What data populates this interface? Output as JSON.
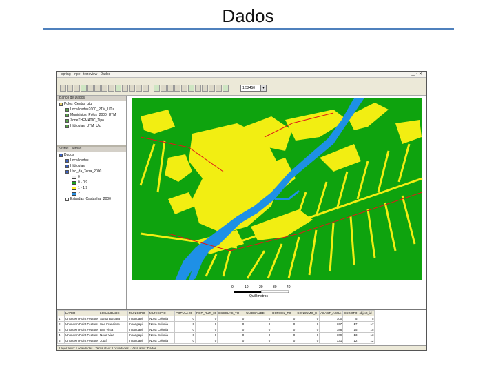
{
  "slide": {
    "title": "Dados"
  },
  "app": {
    "window_title": "spring - inpe - terraview - Dados",
    "scale_value": "1:52450",
    "toolbar_icons": [
      "new-icon",
      "open-icon",
      "save-icon",
      "layer-icon",
      "view-icon",
      "table-icon",
      "print-icon",
      "add-theme-icon",
      "query-icon",
      "legend-icon",
      "graph-icon",
      "refresh-icon",
      "text-icon",
      "pointer-icon",
      "zoom-in-icon",
      "zoom-out-icon",
      "pan-icon",
      "info-icon",
      "select-icon",
      "measure-icon",
      "edit-icon",
      "draw-icon",
      "area-icon",
      "color-icon"
    ]
  },
  "database_panel": {
    "header": "Banco de Dados",
    "items": [
      {
        "label": "Polos_Centro_utu",
        "color": "#e8d070"
      },
      {
        "label": "Localidades2000_PTM_UTu",
        "color": "#5aa84a"
      },
      {
        "label": "Municipios_Polos_2000_UTM",
        "color": "#5aa84a"
      },
      {
        "label": "ZoneTHEMATIC_Tipo",
        "color": "#5aa84a"
      },
      {
        "label": "Hidrovias_UTM_Utp",
        "color": "#5aa84a"
      }
    ]
  },
  "views_panel": {
    "header": "Vistas / Temas",
    "items": [
      {
        "label": "Dados",
        "indent": 0,
        "checked": true
      },
      {
        "label": "Localidades",
        "indent": 1,
        "checked": true
      },
      {
        "label": "Hidrovias",
        "indent": 1,
        "checked": true
      },
      {
        "label": "Uso_da_Terra_2000",
        "indent": 1,
        "checked": true
      },
      {
        "label": "0",
        "indent": 2,
        "swatch": "#f0f0f0"
      },
      {
        "label": "0 - 0.9",
        "indent": 2,
        "swatch": "#1f9e1f"
      },
      {
        "label": "1 - 1.9",
        "indent": 2,
        "swatch": "#ffee22"
      },
      {
        "label": "2",
        "indent": 2,
        "swatch": "#2a8fe0"
      },
      {
        "label": "Estradas_Castanhal_2000",
        "indent": 1,
        "checked": false
      }
    ]
  },
  "map": {
    "colors": {
      "forest": "#0ea30e",
      "deforested": "#f2ee12",
      "river": "#1e90e6",
      "road": "#e01818"
    },
    "scale_ticks": [
      "0",
      "10",
      "20",
      "30",
      "40"
    ],
    "scale_unit": "Quilômetros"
  },
  "table": {
    "columns": [
      "",
      "LAYER",
      "LOCALIDADE",
      "MUNICIPIO",
      "MUNICIPIO",
      "POPULA 00",
      "POP_RUR_00",
      "ESCOLAS_TO",
      "UNIDSAUDE",
      "DOMICIL_TO",
      "CONSUMO_E",
      "ABAST_AGUA",
      "ESGOTO",
      "object_id"
    ],
    "rows": [
      [
        "1",
        "Unknown Point Feature",
        "Santa Barbara",
        "Inhangapi",
        "Nova Colonia",
        "0",
        "0",
        "0",
        "0",
        "0",
        "0",
        "100",
        "5",
        "5"
      ],
      [
        "2",
        "Unknown Point Feature",
        "Sao Francisco",
        "Inhangapi",
        "Nova Colonia",
        "0",
        "0",
        "0",
        "0",
        "0",
        "0",
        "167",
        "17",
        "17"
      ],
      [
        "3",
        "Unknown Point Feature",
        "Boa Vista",
        "Inhangapi",
        "Nova Colonia",
        "0",
        "0",
        "0",
        "0",
        "0",
        "0",
        "188",
        "15",
        "15"
      ],
      [
        "4",
        "Unknown Point Feature",
        "Nova Vida",
        "Inhangapi",
        "Nova Colonia",
        "0",
        "0",
        "0",
        "0",
        "0",
        "0",
        "109",
        "13",
        "13"
      ],
      [
        "5",
        "Unknown Point Feature",
        "Jutaí",
        "Inhangapi",
        "Nova Colonia",
        "0",
        "0",
        "0",
        "0",
        "0",
        "0",
        "131",
        "12",
        "12"
      ]
    ]
  },
  "status": {
    "text": "Layer ativo: Localidades - Tema ativo: Localidades - Vista ativa: Dados"
  }
}
